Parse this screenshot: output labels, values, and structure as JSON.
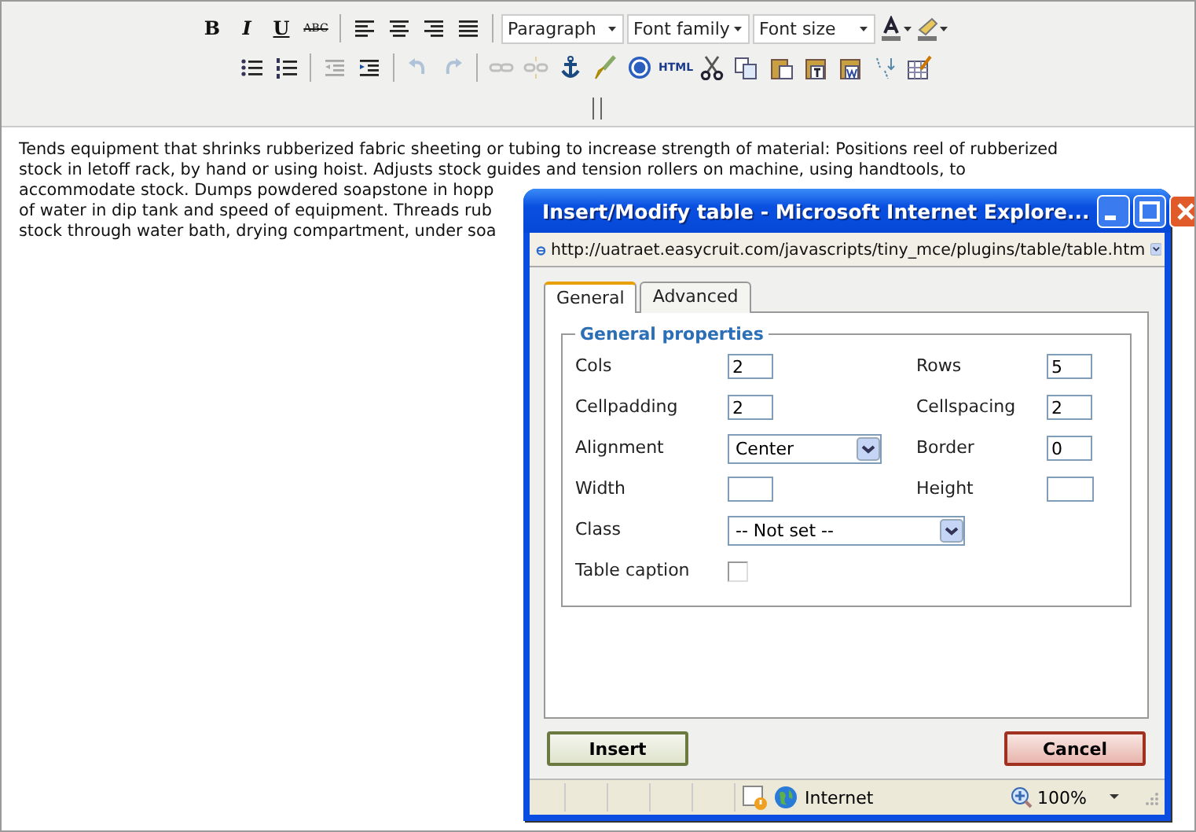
{
  "toolbar": {
    "row1": [
      {
        "kind": "text",
        "label": "B"
      },
      {
        "kind": "text",
        "label": "I"
      },
      {
        "kind": "text",
        "label": "U"
      },
      {
        "kind": "text",
        "label": "ABC"
      },
      {
        "kind": "sep"
      },
      {
        "kind": "icon"
      },
      {
        "kind": "icon"
      },
      {
        "kind": "icon"
      },
      {
        "kind": "icon"
      },
      {
        "kind": "sep"
      },
      {
        "kind": "select",
        "label": "Paragraph"
      },
      {
        "kind": "select",
        "label": "Font family"
      },
      {
        "kind": "select",
        "label": "Font size"
      },
      {
        "kind": "icon"
      },
      {
        "kind": "icon"
      }
    ],
    "row2": [
      {
        "kind": "icon",
        "disabled": false
      },
      {
        "kind": "icon",
        "disabled": false
      },
      {
        "kind": "sep"
      },
      {
        "kind": "icon",
        "disabled": true
      },
      {
        "kind": "icon",
        "disabled": false
      },
      {
        "kind": "sep"
      },
      {
        "kind": "icon",
        "disabled": true
      },
      {
        "kind": "icon",
        "disabled": true
      },
      {
        "kind": "sep"
      },
      {
        "kind": "icon",
        "disabled": true
      },
      {
        "kind": "icon",
        "disabled": true
      },
      {
        "kind": "icon",
        "disabled": false
      },
      {
        "kind": "icon",
        "disabled": false
      },
      {
        "kind": "icon",
        "disabled": false
      },
      {
        "kind": "text",
        "label": "HTML",
        "disabled": false
      },
      {
        "kind": "icon",
        "disabled": false
      },
      {
        "kind": "icon",
        "disabled": false
      },
      {
        "kind": "icon",
        "disabled": false
      },
      {
        "kind": "icon",
        "disabled": false
      },
      {
        "kind": "icon",
        "disabled": false
      },
      {
        "kind": "icon",
        "disabled": false
      },
      {
        "kind": "icon",
        "disabled": false
      }
    ]
  },
  "editor": {
    "lines": [
      "Tends equipment that shrinks rubberized fabric sheeting or tubing to increase strength of material: Positions reel of rubberized",
      "stock in letoff rack, by hand or using hoist. Adjusts stock guides and tension rollers on machine, using handtools, to",
      "accommodate stock. Dumps powdered soapstone in hopp",
      "of water in dip tank and speed of equipment. Threads rub",
      "stock through water bath, drying compartment, under soa"
    ]
  },
  "dialog": {
    "title": "Insert/Modify table - Microsoft Internet Explore...",
    "address": "http://uatraet.easycruit.com/javascripts/tiny_mce/plugins/table/table.htm",
    "tabs": [
      {
        "label": "General",
        "selected": true
      },
      {
        "label": "Advanced",
        "selected": false
      }
    ],
    "legend": "General properties",
    "fields": [
      {
        "label": "Cols",
        "kind": "text",
        "value": "2"
      },
      {
        "label": "Rows",
        "kind": "text",
        "value": "5"
      },
      {
        "label": "Cellpadding",
        "kind": "text",
        "value": "2"
      },
      {
        "label": "Cellspacing",
        "kind": "text",
        "value": "2"
      },
      {
        "label": "Alignment",
        "kind": "select",
        "value": "Center"
      },
      {
        "label": "Border",
        "kind": "text",
        "value": "0"
      },
      {
        "label": "Width",
        "kind": "text"
      },
      {
        "label": "Height",
        "kind": "wide-text"
      },
      {
        "label": "Class",
        "kind": "long-select",
        "value": "-- Not set --"
      },
      {
        "label": "Table caption",
        "kind": "checkbox",
        "checked": false
      }
    ],
    "buttons": [
      {
        "label": "Insert",
        "kind": "ok"
      },
      {
        "label": "Cancel",
        "kind": "cancel"
      }
    ],
    "status_bar": {
      "zone": "Internet",
      "zoom": "100%"
    }
  }
}
